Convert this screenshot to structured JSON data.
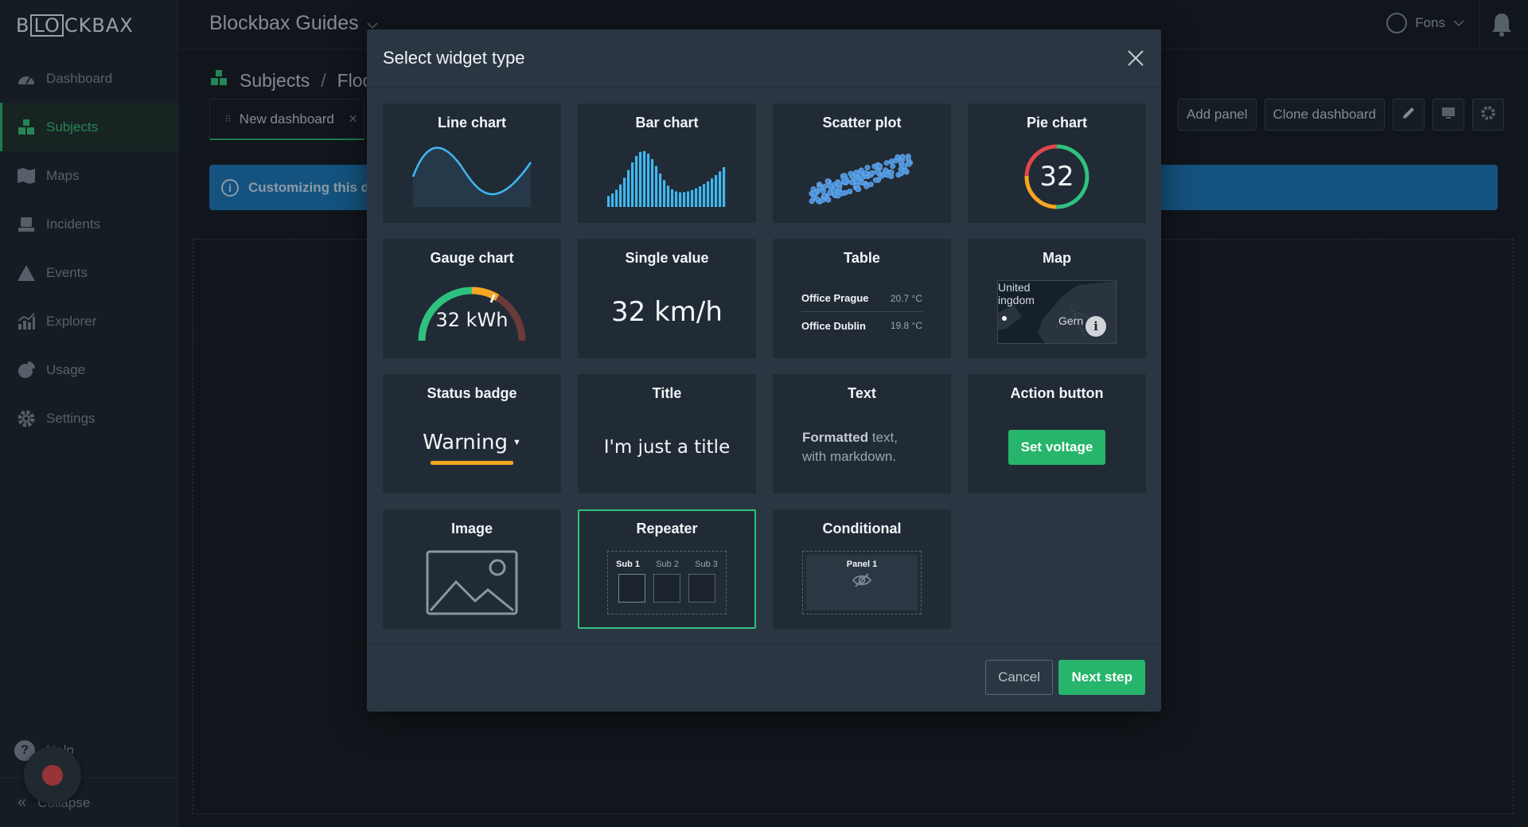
{
  "app": {
    "logo_pre": "B",
    "logo_box": "LO",
    "logo_post": "CKBAX",
    "title": "Blockbax Guides",
    "user": "Fons"
  },
  "sidebar": {
    "items": [
      {
        "label": "Dashboard",
        "icon": "gauge-icon"
      },
      {
        "label": "Subjects",
        "icon": "cubes-icon"
      },
      {
        "label": "Maps",
        "icon": "map-icon"
      },
      {
        "label": "Incidents",
        "icon": "incident-icon"
      },
      {
        "label": "Events",
        "icon": "warning-icon"
      },
      {
        "label": "Explorer",
        "icon": "chart-icon"
      },
      {
        "label": "Usage",
        "icon": "pie-icon"
      },
      {
        "label": "Settings",
        "icon": "gear-icon"
      }
    ],
    "help_label": "Help",
    "collapse_label": "Collapse"
  },
  "page": {
    "breadcrumb": [
      "Subjects",
      "Floo"
    ],
    "tab_label": "New dashboard",
    "toolbar": {
      "add_panel": "Add panel",
      "clone_dashboard": "Clone dashboard"
    },
    "info_text": "Customizing this da"
  },
  "modal": {
    "title": "Select widget type",
    "cards": {
      "line_chart": "Line chart",
      "bar_chart": "Bar chart",
      "scatter_plot": "Scatter plot",
      "pie_chart": {
        "title": "Pie chart",
        "value": "32"
      },
      "gauge_chart": {
        "title": "Gauge chart",
        "value": "32 kWh"
      },
      "single_value": {
        "title": "Single value",
        "value": "32 km/h"
      },
      "table": {
        "title": "Table",
        "rows": [
          {
            "name": "Office Prague",
            "value": "20.7 °C"
          },
          {
            "name": "Office Dublin",
            "value": "19.8 °C"
          }
        ]
      },
      "map": {
        "title": "Map",
        "label1": "United\ningdom",
        "label2": "Gern"
      },
      "status_badge": {
        "title": "Status badge",
        "value": "Warning"
      },
      "title_widget": {
        "title": "Title",
        "value": "I'm just a title"
      },
      "text": {
        "title": "Text",
        "bold": "Formatted",
        "rest1": " text,",
        "line2": "with markdown."
      },
      "action_button": {
        "title": "Action button",
        "button": "Set voltage"
      },
      "image": "Image",
      "repeater": {
        "title": "Repeater",
        "subs": [
          "Sub 1",
          "Sub 2",
          "Sub 3"
        ]
      },
      "conditional": {
        "title": "Conditional",
        "panel": "Panel 1"
      }
    },
    "footer": {
      "cancel": "Cancel",
      "next": "Next step"
    }
  },
  "colors": {
    "accent": "#27b56b",
    "info": "#1977b8",
    "warning": "#f5a623",
    "line": "#3fb8f0"
  }
}
